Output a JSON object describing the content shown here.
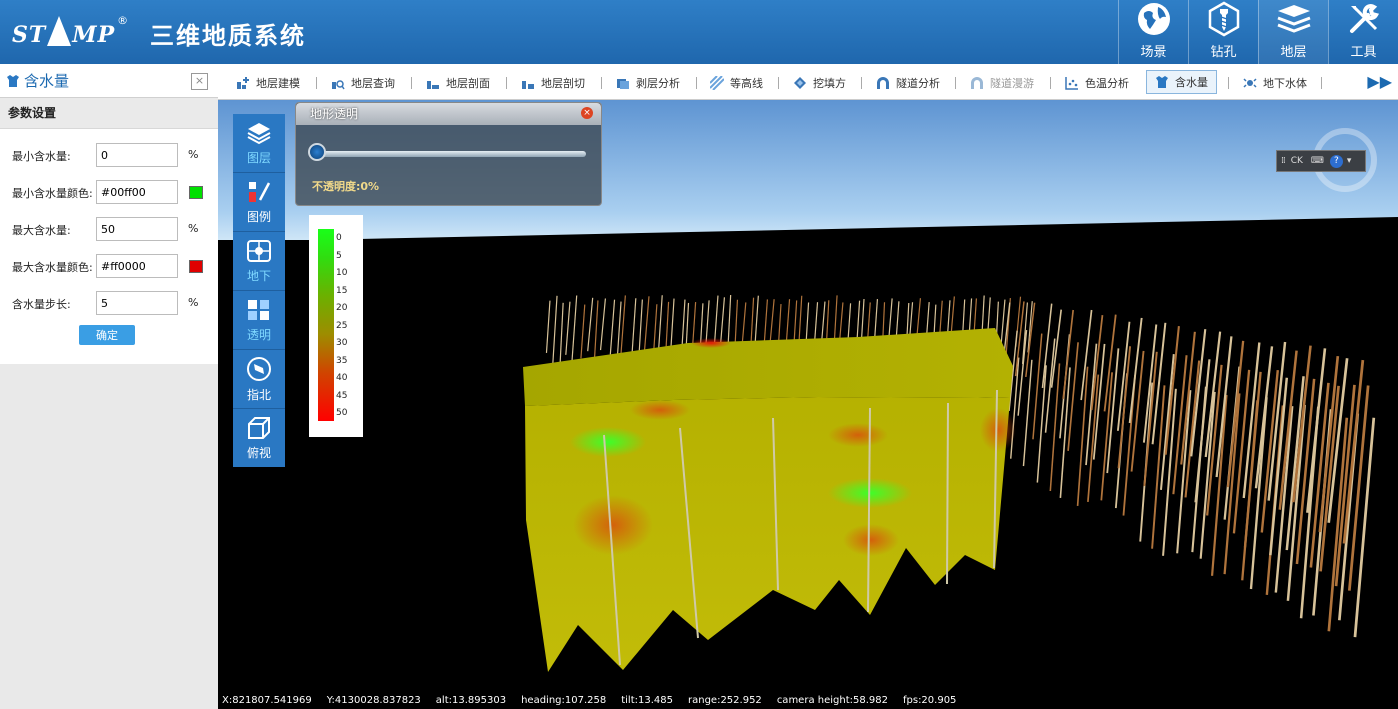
{
  "header": {
    "brand": "ST",
    "brand_tail": "MP",
    "reg": "®",
    "title": "三维地质系统",
    "nav": [
      {
        "label": "场景",
        "icon": "globe-icon"
      },
      {
        "label": "钻孔",
        "icon": "drill-icon"
      },
      {
        "label": "地层",
        "icon": "layers-icon"
      },
      {
        "label": "工具",
        "icon": "tools-icon"
      }
    ]
  },
  "left_panel": {
    "title": "含水量",
    "close": "×",
    "section": "参数设置",
    "fields": {
      "min_water": {
        "label": "最小含水量:",
        "value": "0",
        "unit": "%"
      },
      "min_color": {
        "label": "最小含水量颜色:",
        "value": "#00ff00",
        "swatch": "#00e000"
      },
      "max_water": {
        "label": "最大含水量:",
        "value": "50",
        "unit": "%"
      },
      "max_color": {
        "label": "最大含水量颜色:",
        "value": "#ff0000",
        "swatch": "#e00000"
      },
      "step": {
        "label": "含水量步长:",
        "value": "5",
        "unit": "%"
      }
    },
    "confirm": "确定"
  },
  "toolbar": {
    "items": [
      {
        "label": "地层建模"
      },
      {
        "label": "地层查询"
      },
      {
        "label": "地层剖面"
      },
      {
        "label": "地层剖切"
      },
      {
        "label": "剥层分析"
      },
      {
        "label": "等高线"
      },
      {
        "label": "挖填方"
      },
      {
        "label": "隧道分析"
      },
      {
        "label": "隧道漫游"
      },
      {
        "label": "色温分析"
      },
      {
        "label": "含水量"
      },
      {
        "label": "地下水体"
      }
    ],
    "more": "▶▶"
  },
  "side_tools": [
    {
      "label": "图层",
      "icon": "layers-stack-icon"
    },
    {
      "label": "图例",
      "icon": "legend-icon"
    },
    {
      "label": "地下",
      "icon": "underground-icon"
    },
    {
      "label": "透明",
      "icon": "transparency-icon"
    },
    {
      "label": "指北",
      "icon": "compass-icon"
    },
    {
      "label": "俯视",
      "icon": "top-view-icon"
    }
  ],
  "terrain_dialog": {
    "title": "地形透明",
    "close": "×",
    "opacity_label": "不透明度:0%",
    "opacity_value": 0
  },
  "legend": {
    "ticks": [
      "0",
      "5",
      "10",
      "15",
      "20",
      "25",
      "30",
      "35",
      "40",
      "45",
      "50"
    ]
  },
  "nav_widget": {
    "text": "CK",
    "help": "?"
  },
  "status": {
    "x": "X:821807.541969",
    "y": "Y:4130028.837823",
    "alt": "alt:13.895303",
    "heading": "heading:107.258",
    "tilt": "tilt:13.485",
    "range": "range:252.952",
    "camera_height": "camera height:58.982",
    "fps": "fps:20.905"
  },
  "colors": {
    "header": "#2672bb",
    "accent": "#1b69b0",
    "model_surface": "#b8b800",
    "low_water": "#19ff19",
    "high_water": "#ff0000"
  }
}
